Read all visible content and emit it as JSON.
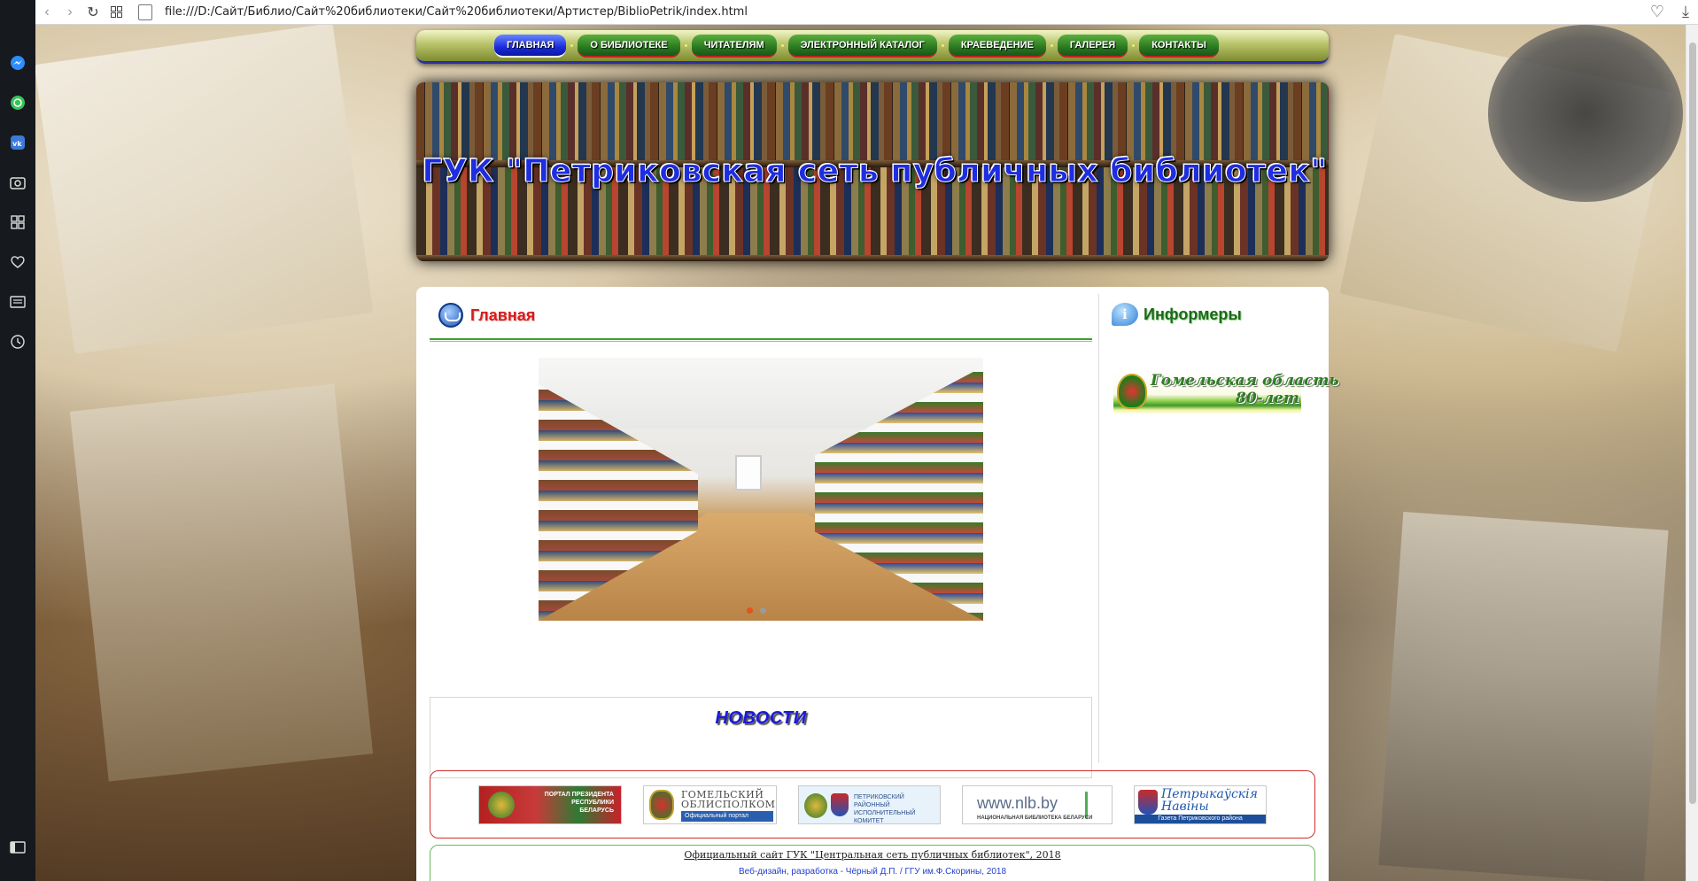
{
  "browser": {
    "url": "file:///D:/Сайт/Библио/Сайт%20библиотеки/Сайт%20библиотеки/Артистер/BiblioPetrik/index.html"
  },
  "nav": {
    "items": [
      {
        "label": "ГЛАВНАЯ",
        "active": true
      },
      {
        "label": "О БИБЛИОТЕКЕ",
        "active": false
      },
      {
        "label": "ЧИТАТЕЛЯМ",
        "active": false
      },
      {
        "label": "ЭЛЕКТРОННЫЙ КАТАЛОГ",
        "active": false
      },
      {
        "label": "КРАЕВЕДЕНИЕ",
        "active": false
      },
      {
        "label": "ГАЛЕРЕЯ",
        "active": false
      },
      {
        "label": "КОНТАКТЫ",
        "active": false
      }
    ]
  },
  "header": {
    "title": "ГУК \"Петриковская сеть публичных библиотек\""
  },
  "main": {
    "title": "Главная",
    "slider": {
      "slides": 2,
      "active_index": 0
    },
    "news_title": "НОВОСТИ"
  },
  "sidebar": {
    "title": "Информеры",
    "informer": {
      "line1": "Гомельская область",
      "line2": "80-лет"
    }
  },
  "partners": {
    "president": "ПОРТАЛ ПРЕЗИДЕНТА РЕСПУБЛИКИ БЕЛАРУСЬ",
    "oblispolkom_title": "ГОМЕЛЬСКИЙ ОБЛИСПОЛКОМ",
    "oblispolkom_sub": "Официальный портал",
    "rayispolkom": "ПЕТРИКОВСКИЙ РАЙОННЫЙ ИСПОЛНИТЕЛЬНЫЙ КОМИТЕТ",
    "nlb_title": "www.nlb.by",
    "nlb_sub": "НАЦИОНАЛЬНАЯ БИБЛИОТЕКА БЕЛАРУСИ",
    "newspaper_title": "Петрыкаўскія Навіны",
    "newspaper_sub": "Газета Петриковского района"
  },
  "footer": {
    "line1": "Официальный сайт ГУК \"Центральная сеть публичных библиотек\", 2018",
    "line2": "Веб-дизайн, разработка - Чёрный Д.П. / ГГУ им.Ф.Скорины, 2018"
  },
  "colors": {
    "accent_red": "#d81c1c",
    "nav_active": "#1a2bdc",
    "nav_item": "#2a7a1e",
    "news_blue": "#1a1ad8"
  }
}
